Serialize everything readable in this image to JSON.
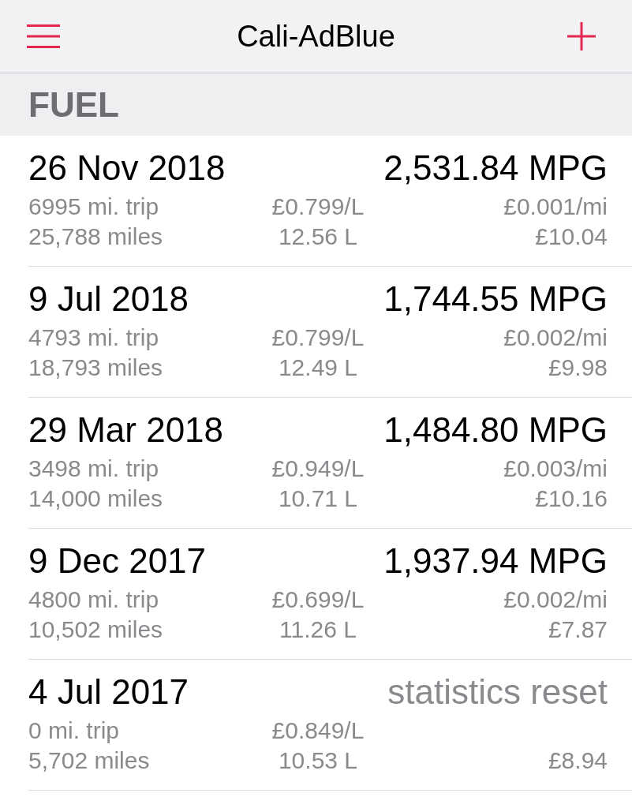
{
  "nav_bar": {
    "title": "Cali-AdBlue"
  },
  "section": {
    "title": "FUEL"
  },
  "entries": [
    {
      "kind": "mpg",
      "date": "26 Nov 2018",
      "headline": "2,531.84 MPG",
      "trip": "6995 mi. trip",
      "price": "£0.799/L",
      "cost_per_mile": "£0.001/mi",
      "odometer": "25,788 miles",
      "volume": "12.56 L",
      "cost": "£10.04"
    },
    {
      "kind": "mpg",
      "date": "9 Jul 2018",
      "headline": "1,744.55 MPG",
      "trip": "4793 mi. trip",
      "price": "£0.799/L",
      "cost_per_mile": "£0.002/mi",
      "odometer": "18,793 miles",
      "volume": "12.49 L",
      "cost": "£9.98"
    },
    {
      "kind": "mpg",
      "date": "29 Mar 2018",
      "headline": "1,484.80 MPG",
      "trip": "3498 mi. trip",
      "price": "£0.949/L",
      "cost_per_mile": "£0.003/mi",
      "odometer": "14,000 miles",
      "volume": "10.71 L",
      "cost": "£10.16"
    },
    {
      "kind": "mpg",
      "date": "9 Dec 2017",
      "headline": "1,937.94 MPG",
      "trip": "4800 mi. trip",
      "price": "£0.699/L",
      "cost_per_mile": "£0.002/mi",
      "odometer": "10,502 miles",
      "volume": "11.26 L",
      "cost": "£7.87"
    },
    {
      "kind": "reset",
      "date": "4 Jul 2017",
      "headline": "statistics reset",
      "trip": "0 mi. trip",
      "price": "£0.849/L",
      "odometer": "5,702 miles",
      "volume": "10.53 L",
      "cost": "£8.94"
    }
  ]
}
